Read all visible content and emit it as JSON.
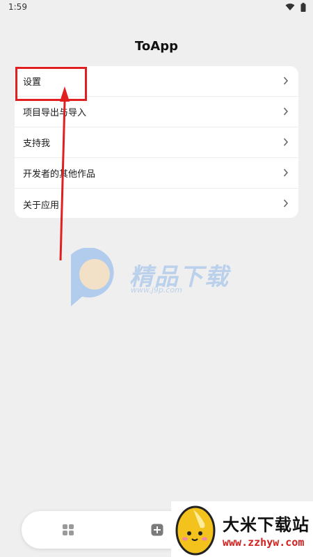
{
  "status_bar": {
    "time": "1:59",
    "icons": [
      "wifi-icon",
      "battery-icon"
    ]
  },
  "app": {
    "title": "ToApp"
  },
  "menu": {
    "items": [
      {
        "label": "设置",
        "icon": "chevron-right-icon"
      },
      {
        "label": "项目导出与导入",
        "icon": "chevron-right-icon"
      },
      {
        "label": "支持我",
        "icon": "chevron-right-icon"
      },
      {
        "label": "开发者的其他作品",
        "icon": "chevron-right-icon"
      },
      {
        "label": "关于应用",
        "icon": "chevron-right-icon"
      }
    ]
  },
  "annotation": {
    "color": "#e02020"
  },
  "watermark_center": {
    "title": "精品下载",
    "url": "www.j9p.com"
  },
  "bottom_nav": {
    "icons": [
      "grid-icon",
      "add-icon"
    ]
  },
  "watermark_corner": {
    "title": "大米下载站",
    "url": "www.zzhyw.com"
  }
}
